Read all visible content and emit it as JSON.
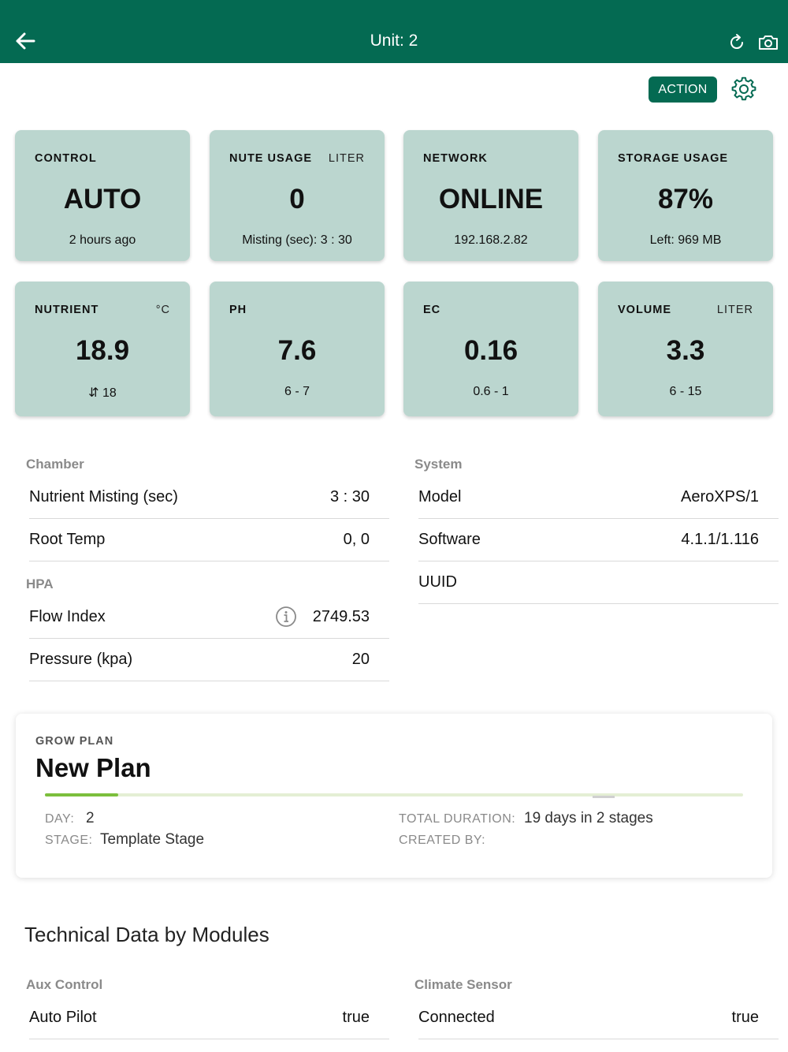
{
  "header": {
    "title": "Unit: 2"
  },
  "toolbar": {
    "action_label": "ACTION"
  },
  "tiles": [
    {
      "label": "CONTROL",
      "unit": "",
      "value": "AUTO",
      "sub": "2 hours ago"
    },
    {
      "label": "NUTE USAGE",
      "unit": "LITER",
      "value": "0",
      "sub": "Misting (sec): 3 : 30"
    },
    {
      "label": "NETWORK",
      "unit": "",
      "value": "ONLINE",
      "sub": "192.168.2.82"
    },
    {
      "label": "STORAGE USAGE",
      "unit": "",
      "value": "87%",
      "sub": "Left: 969 MB"
    },
    {
      "label": "NUTRIENT",
      "unit": "°C",
      "value": "18.9",
      "sub": "⇵ 18"
    },
    {
      "label": "PH",
      "unit": "",
      "value": "7.6",
      "sub": "6 - 7"
    },
    {
      "label": "EC",
      "unit": "",
      "value": "0.16",
      "sub": "0.6 - 1"
    },
    {
      "label": "VOLUME",
      "unit": "LITER",
      "value": "3.3",
      "sub": "6 - 15"
    }
  ],
  "chamber": {
    "title": "Chamber",
    "rows": [
      {
        "key": "Nutrient Misting (sec)",
        "value": "3 : 30"
      },
      {
        "key": "Root Temp",
        "value": "0, 0"
      }
    ]
  },
  "hpa": {
    "title": "HPA",
    "rows": [
      {
        "key": "Flow Index",
        "value": "2749.53"
      },
      {
        "key": "Pressure (kpa)",
        "value": "20"
      }
    ]
  },
  "system": {
    "title": "System",
    "rows": [
      {
        "key": "Model",
        "value": "AeroXPS/1"
      },
      {
        "key": "Software",
        "value": "4.1.1/1.116"
      },
      {
        "key": "UUID",
        "value": ""
      }
    ]
  },
  "grow_plan": {
    "label": "GROW PLAN",
    "name": "New Plan",
    "progress": 0.105,
    "day_label": "DAY:",
    "day_value": "2",
    "stage_label": "STAGE:",
    "stage_value": "Template Stage",
    "duration_label": "TOTAL DURATION:",
    "duration_value": "19 days in 2 stages",
    "created_label": "CREATED BY:",
    "created_value": ""
  },
  "technical": {
    "title": "Technical Data by Modules",
    "aux": {
      "title": "Aux Control",
      "rows": [
        {
          "key": "Auto Pilot",
          "value": "true"
        }
      ]
    },
    "climate": {
      "title": "Climate Sensor",
      "rows": [
        {
          "key": "Connected",
          "value": "true"
        }
      ]
    }
  },
  "colors": {
    "header": "#046a52",
    "tile": "#bbd6cf",
    "progress": "#7cbf3c"
  }
}
